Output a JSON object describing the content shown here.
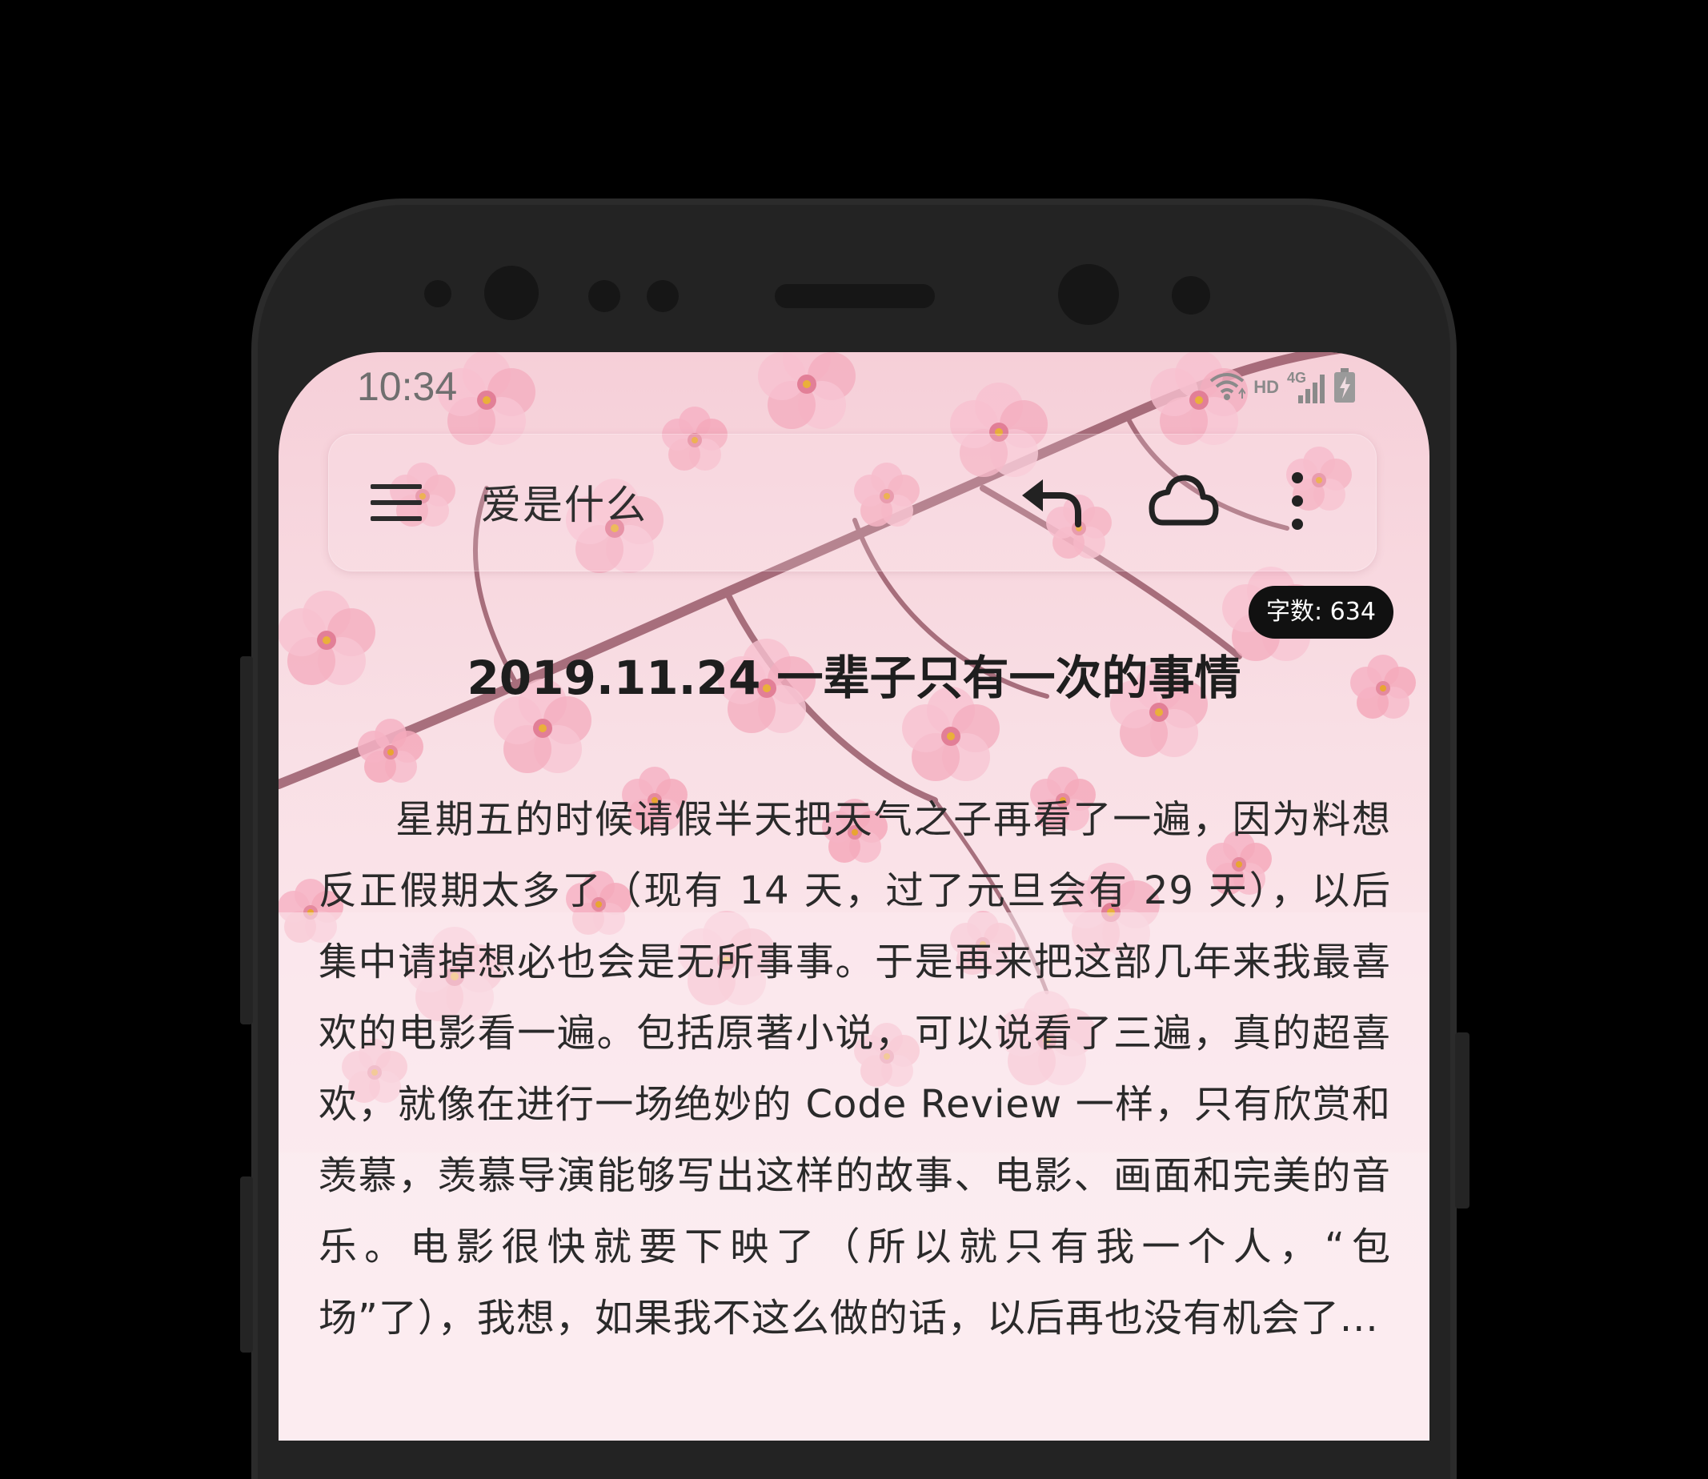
{
  "status_bar": {
    "time": "10:34",
    "hd_label": "HD",
    "network_label": "4G",
    "icons": [
      "wifi-icon",
      "signal-icon",
      "battery-charging-icon"
    ]
  },
  "toolbar": {
    "title": "爱是什么",
    "icons": [
      "menu-icon",
      "undo-icon",
      "cloud-icon",
      "more-vert-icon"
    ]
  },
  "word_count": "字数: 634",
  "article": {
    "title": "2019.11.24 一辈子只有一次的事情",
    "body": "星期五的时候请假半天把天气之子再看了一遍，因为料想反正假期太多了（现有 14 天，过了元旦会有 29 天），以后集中请掉想必也会是无所事事。于是再来把这部几年来我最喜欢的电影看一遍。包括原著小说，可以说看了三遍，真的超喜欢，就像在进行一场绝妙的 Code Review 一样，只有欣赏和羡慕，羡慕导演能够写出这样的故事、电影、画面和完美的音乐。电影很快就要下映了（所以就只有我一个人，“包场”了），我想，如果我不这么做的话，以后再也没有机会了..."
  },
  "colors": {
    "background": "#000000",
    "phone_frame": "#2b2b2b",
    "screen_bg": "#f9dfe5",
    "blossom": "#f4a9bb",
    "branch": "#8c4a5a",
    "stamen": "#e9a530",
    "badge_bg": "#111111",
    "text": "#2a2a2a"
  }
}
